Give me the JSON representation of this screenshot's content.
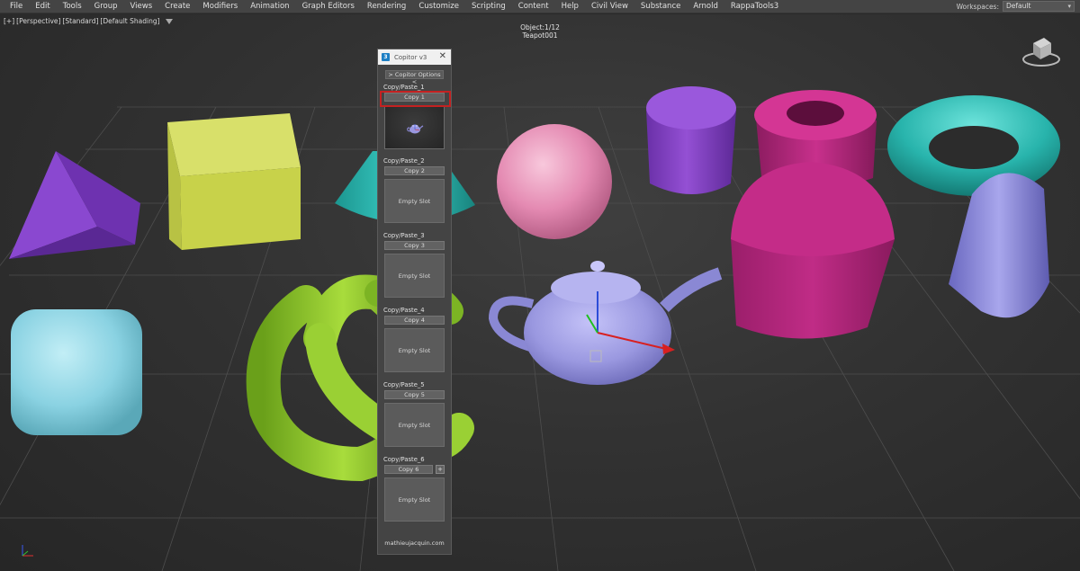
{
  "menubar": {
    "items": [
      "File",
      "Edit",
      "Tools",
      "Group",
      "Views",
      "Create",
      "Modifiers",
      "Animation",
      "Graph Editors",
      "Rendering",
      "Customize",
      "Scripting",
      "Content",
      "Help",
      "Civil View",
      "Substance",
      "Arnold",
      "RappaTools3"
    ],
    "workspaces_label": "Workspaces:",
    "workspace_value": "Default"
  },
  "viewport": {
    "label_plus": "[+]",
    "label_view": "[Perspective]",
    "label_mode": "[Standard]",
    "label_shading": "[Default Shading]",
    "object_count": "Object:1/12",
    "object_name": "Teapot001"
  },
  "copitor": {
    "title": "Copitor v3",
    "options_label": "> Copitor Options <",
    "slots": [
      {
        "label": "Copy/Paste_1",
        "button": "Copy 1",
        "thumb": ""
      },
      {
        "label": "Copy/Paste_2",
        "button": "Copy 2",
        "thumb": "Empty Slot"
      },
      {
        "label": "Copy/Paste_3",
        "button": "Copy 3",
        "thumb": "Empty Slot"
      },
      {
        "label": "Copy/Paste_4",
        "button": "Copy 4",
        "thumb": "Empty Slot"
      },
      {
        "label": "Copy/Paste_5",
        "button": "Copy 5",
        "thumb": "Empty Slot"
      },
      {
        "label": "Copy/Paste_6",
        "button": "Copy 6",
        "thumb": "Empty Slot"
      }
    ],
    "plus_label": "+",
    "footer": "mathieujacquin.com"
  },
  "colors": {
    "highlight": "#c42121",
    "purple": "#8a48c8",
    "yellow_green": "#c8d24a",
    "teal": "#27b8b0",
    "pink": "#e890b8",
    "magenta": "#b0287a",
    "lavender": "#9a98e0",
    "light_cyan": "#8fd6e4",
    "green": "#8ac22a"
  },
  "icons": {
    "app": "3ds-max-icon",
    "close": "close-icon",
    "filter": "filter-icon",
    "viewcube": "viewcube-icon"
  }
}
